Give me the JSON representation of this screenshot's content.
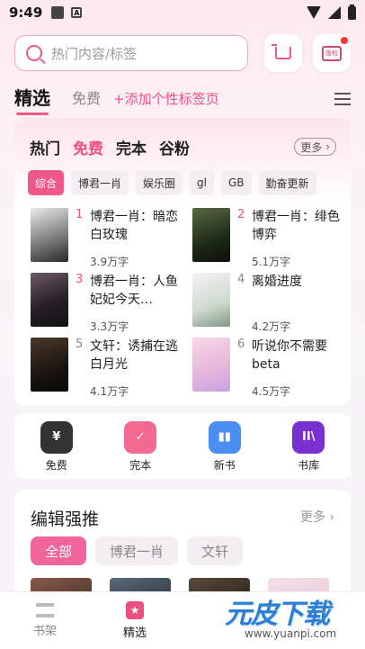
{
  "status": {
    "time": "9:49",
    "a_icon": "A"
  },
  "search": {
    "placeholder": "热门内容/标签"
  },
  "header": {
    "vip_label": "版权"
  },
  "tabs": {
    "main": "精选",
    "free": "免费",
    "add": "+添加个性标签页"
  },
  "ranking": {
    "categories": [
      "热门",
      "免费",
      "完本",
      "谷粉"
    ],
    "active_category": "免费",
    "more": "更多",
    "filters": [
      "综合",
      "博君一肖",
      "娱乐圈",
      "gl",
      "GB",
      "勤奋更新"
    ],
    "books": [
      {
        "rank": "1",
        "title": "博君一肖：暗恋白玫瑰",
        "count": "3.9万字"
      },
      {
        "rank": "2",
        "title": "博君一肖：绯色博弈",
        "count": "5.1万字"
      },
      {
        "rank": "3",
        "title": "博君一肖：人鱼妃妃今天…",
        "count": "3.3万字"
      },
      {
        "rank": "4",
        "title": "离婚进度",
        "count": "4.2万字"
      },
      {
        "rank": "5",
        "title": "文轩：诱捕在逃白月光",
        "count": "4.1万字"
      },
      {
        "rank": "6",
        "title": "听说你不需要beta",
        "count": "4.5万字"
      }
    ]
  },
  "quick": [
    {
      "label": "免费",
      "icon": "yen-icon",
      "color": "#333333",
      "glyph": "¥"
    },
    {
      "label": "完本",
      "icon": "check-icon",
      "color": "#f26a92",
      "glyph": "✓"
    },
    {
      "label": "新书",
      "icon": "book-icon",
      "color": "#4a8ff0",
      "glyph": "▮▮"
    },
    {
      "label": "书库",
      "icon": "library-icon",
      "color": "#7a2fd0",
      "glyph": "II\\"
    }
  ],
  "editor": {
    "title": "编辑强推",
    "more": "更多",
    "chips": [
      "全部",
      "博君一肖",
      "文轩"
    ]
  },
  "nav": {
    "shelf": "书架",
    "featured": "精选"
  },
  "watermark": {
    "text": "元皮下载",
    "url": "www.yuanpi.com"
  },
  "colors": {
    "accent": "#ee4f80"
  }
}
